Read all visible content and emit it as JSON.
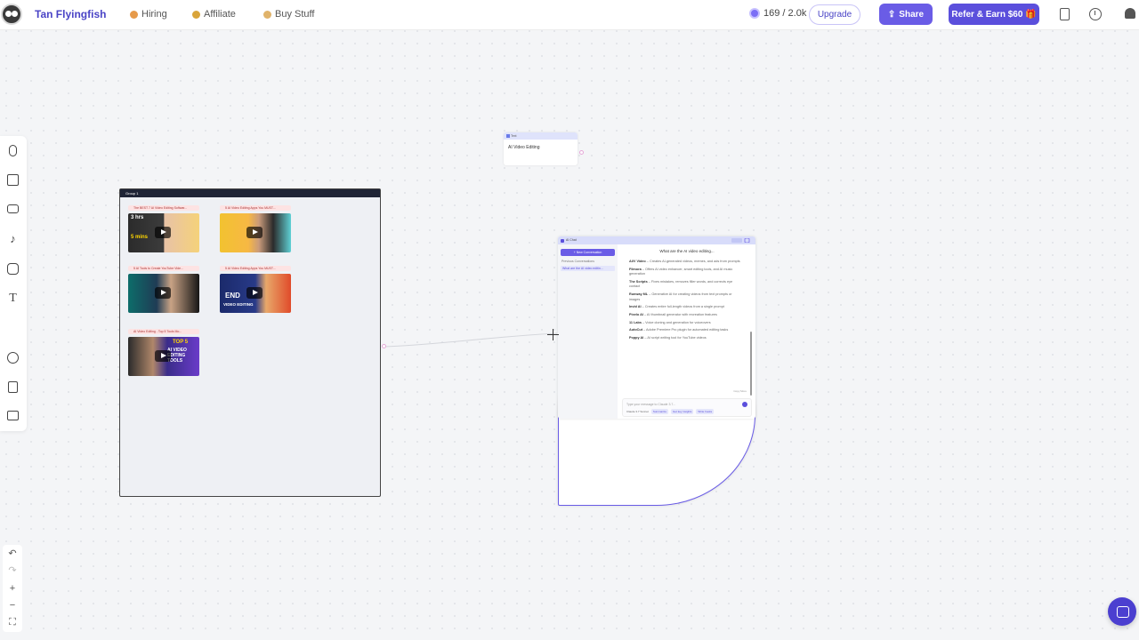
{
  "topbar": {
    "brand": "Tan Flyingfish",
    "nav": [
      {
        "label": "Hiring",
        "icon": "hiring-emoji-icon"
      },
      {
        "label": "Affiliate",
        "icon": "affiliate-emoji-icon"
      },
      {
        "label": "Buy Stuff",
        "icon": "buy-stuff-emoji-icon"
      }
    ],
    "credits": "169 / 2.0k",
    "upgrade_label": "Upgrade",
    "share_label": "Share",
    "refer_label": "Refer & Earn $60 🎁"
  },
  "sidebar": {
    "tools": [
      "microphone-icon",
      "image-icon",
      "video-icon",
      "tiktok-icon",
      "instagram-icon",
      "text-icon",
      "ai-chat-icon",
      "globe-icon",
      "document-icon",
      "folder-icon"
    ]
  },
  "zoom": {
    "undo": "↶",
    "redo": "↷",
    "zoom_in": "+",
    "zoom_out": "−",
    "fit": "⛶"
  },
  "group": {
    "title": "Group 1",
    "videos": [
      {
        "title": "The BEST 7 AI Video Editing Softwar...",
        "caption_top": "3 hrs",
        "caption_bottom": "5 mins"
      },
      {
        "title": "5 AI Video Editing Apps You MUST...",
        "caption_top": "",
        "caption_bottom": ""
      },
      {
        "title": "5 AI Tools to Create YouTube Vide...",
        "caption_top": "",
        "caption_bottom": ""
      },
      {
        "title": "5 AI Video Editing Apps You MUST...",
        "caption_top": "END",
        "caption_bottom": "VIDEO EDITING"
      },
      {
        "title": "AI Video Editing - Top 5 Tools Mo...",
        "caption_top": "TOP 5",
        "caption_bottom": "AI VIDEO EDITING TOOLS"
      }
    ]
  },
  "text_node": {
    "label": "Text",
    "content": "AI Video Editing"
  },
  "chat": {
    "header": "AI Chat",
    "new_conversation": "+ New Conversation",
    "previous_label": "Previous Conversations",
    "previous_item": "What are the AI video editin...",
    "question": "What are the AI video editing...",
    "answers": [
      {
        "name": "AI/V Video",
        "desc": "Creates AI-generated videos, memes, and ads from prompts"
      },
      {
        "name": "Filmora",
        "desc": "Offers AI video enhancer, smart editing tools, and AI music generation"
      },
      {
        "name": "The Scripts",
        "desc": "Fixes mistakes, removes filler words, and corrects eye contact"
      },
      {
        "name": "Runway ML",
        "desc": "Generative AI for creating videos from text prompts or images"
      },
      {
        "name": "Invid AI",
        "desc": "Creates entire full-length videos from a single prompt"
      },
      {
        "name": "Pixelo AI",
        "desc": "AI thumbnail generator with recreation features"
      },
      {
        "name": "11 Labs",
        "desc": "Voice cloning and generation for voiceovers"
      },
      {
        "name": "AutoCut",
        "desc": "Adobe Premiere Pro plugin for automated editing tasks"
      },
      {
        "name": "Poppy AI",
        "desc": "AI script writing tool for YouTube videos"
      }
    ],
    "meta": "Copy   More",
    "input_placeholder": "Type your message to Claude 3.7...",
    "model": "Claude 3.7 Sonnet",
    "chips": [
      "Summarize",
      "Get key insights",
      "Write hooks"
    ]
  },
  "colors": {
    "accent": "#5b4fdc",
    "brand": "#4a44c6"
  }
}
